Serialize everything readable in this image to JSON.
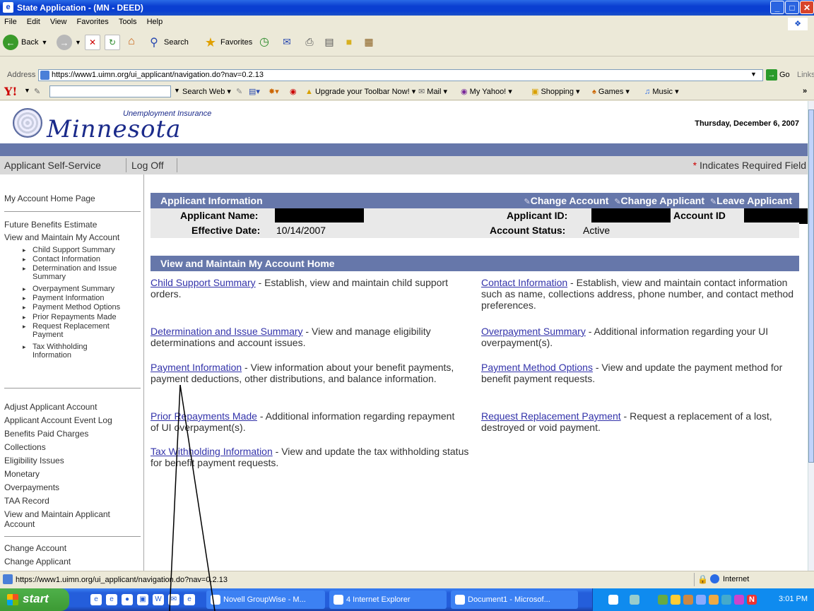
{
  "window": {
    "title": "State Application - (MN - DEED)"
  },
  "menubar": {
    "items": [
      "File",
      "Edit",
      "View",
      "Favorites",
      "Tools",
      "Help"
    ]
  },
  "toolbar": {
    "back_label": "Back",
    "search_label": "Search",
    "favorites_label": "Favorites"
  },
  "address": {
    "label": "Address",
    "url": "https://www1.uimn.org/ui_applicant/navigation.do?nav=0.2.13",
    "go_label": "Go",
    "links_label": "Links"
  },
  "yahoo": {
    "search_label": "Search Web",
    "upgrade_label": "Upgrade your Toolbar Now!",
    "mail_label": "Mail",
    "myyahoo_label": "My Yahoo!",
    "shopping_label": "Shopping",
    "games_label": "Games",
    "music_label": "Music"
  },
  "page": {
    "header": {
      "ui_label": "Unemployment Insurance",
      "logo_text": "Minnesota",
      "date": "Thursday, December 6, 2007"
    },
    "nav": {
      "self_service": "Applicant Self-Service",
      "logoff": "Log Off",
      "req_star": "*",
      "required_note": "Indicates Required Field"
    },
    "left_nav": {
      "home": "My Account Home Page",
      "future_benefits": "Future Benefits Estimate",
      "view_maintain": "View and Maintain My Account",
      "sub_items": [
        "Child Support Summary",
        "Contact Information",
        "Determination and Issue Summary",
        "Overpayment Summary",
        "Payment Information",
        "Payment Method Options",
        "Prior Repayments Made",
        "Request Replacement Payment",
        "Tax Withholding Information"
      ],
      "admin_items": [
        "Adjust Applicant Account",
        "Applicant Account Event Log",
        "Benefits Paid Charges",
        "Collections",
        "Eligibility Issues",
        "Monetary",
        "Overpayments",
        "TAA Record",
        "View and Maintain Applicant Account"
      ],
      "change_account": "Change Account",
      "change_applicant": "Change Applicant"
    },
    "applicant_info": {
      "heading": "Applicant Information",
      "change_account": "Change Account",
      "change_applicant": "Change Applicant",
      "leave_applicant": "Leave Applicant",
      "name_label": "Applicant Name:",
      "id_label": "Applicant ID:",
      "account_id_label": "Account ID",
      "effective_label": "Effective Date:",
      "effective_value": "10/14/2007",
      "status_label": "Account Status:",
      "status_value": "Active"
    },
    "home": {
      "heading": "View and Maintain My Account Home",
      "entries": [
        {
          "link": "Child Support Summary",
          "desc": " - Establish, view and maintain child support orders."
        },
        {
          "link": "Contact Information",
          "desc": " - Establish, view and maintain contact information such as name, collections address, phone number, and contact method preferences."
        },
        {
          "link": "Determination and Issue Summary",
          "desc": " - View and manage eligibility determinations and account issues."
        },
        {
          "link": "Overpayment Summary",
          "desc": " - Additional information regarding your UI overpayment(s)."
        },
        {
          "link": "Payment Information",
          "desc": " - View information about your benefit payments, payment deductions, other distributions, and balance information."
        },
        {
          "link": "Payment Method Options",
          "desc": " - View and update the payment method for benefit payment requests."
        },
        {
          "link": "Prior Repayments Made",
          "desc": " - Additional information regarding repayment of UI overpayment(s)."
        },
        {
          "link": "Request Replacement Payment",
          "desc": " - Request a replacement of a lost, destroyed or void payment."
        },
        {
          "link": "Tax Withholding Information",
          "desc": " - View and update the tax withholding status for benefit payment requests."
        }
      ]
    }
  },
  "statusbar": {
    "url": "https://www1.uimn.org/ui_applicant/navigation.do?nav=0.2.13",
    "zone": "Internet"
  },
  "taskbar": {
    "start_label": "start",
    "tasks": [
      "Novell GroupWise - M...",
      "4 Internet Explorer",
      "Document1 - Microsof..."
    ],
    "clock": "3:01 PM"
  }
}
